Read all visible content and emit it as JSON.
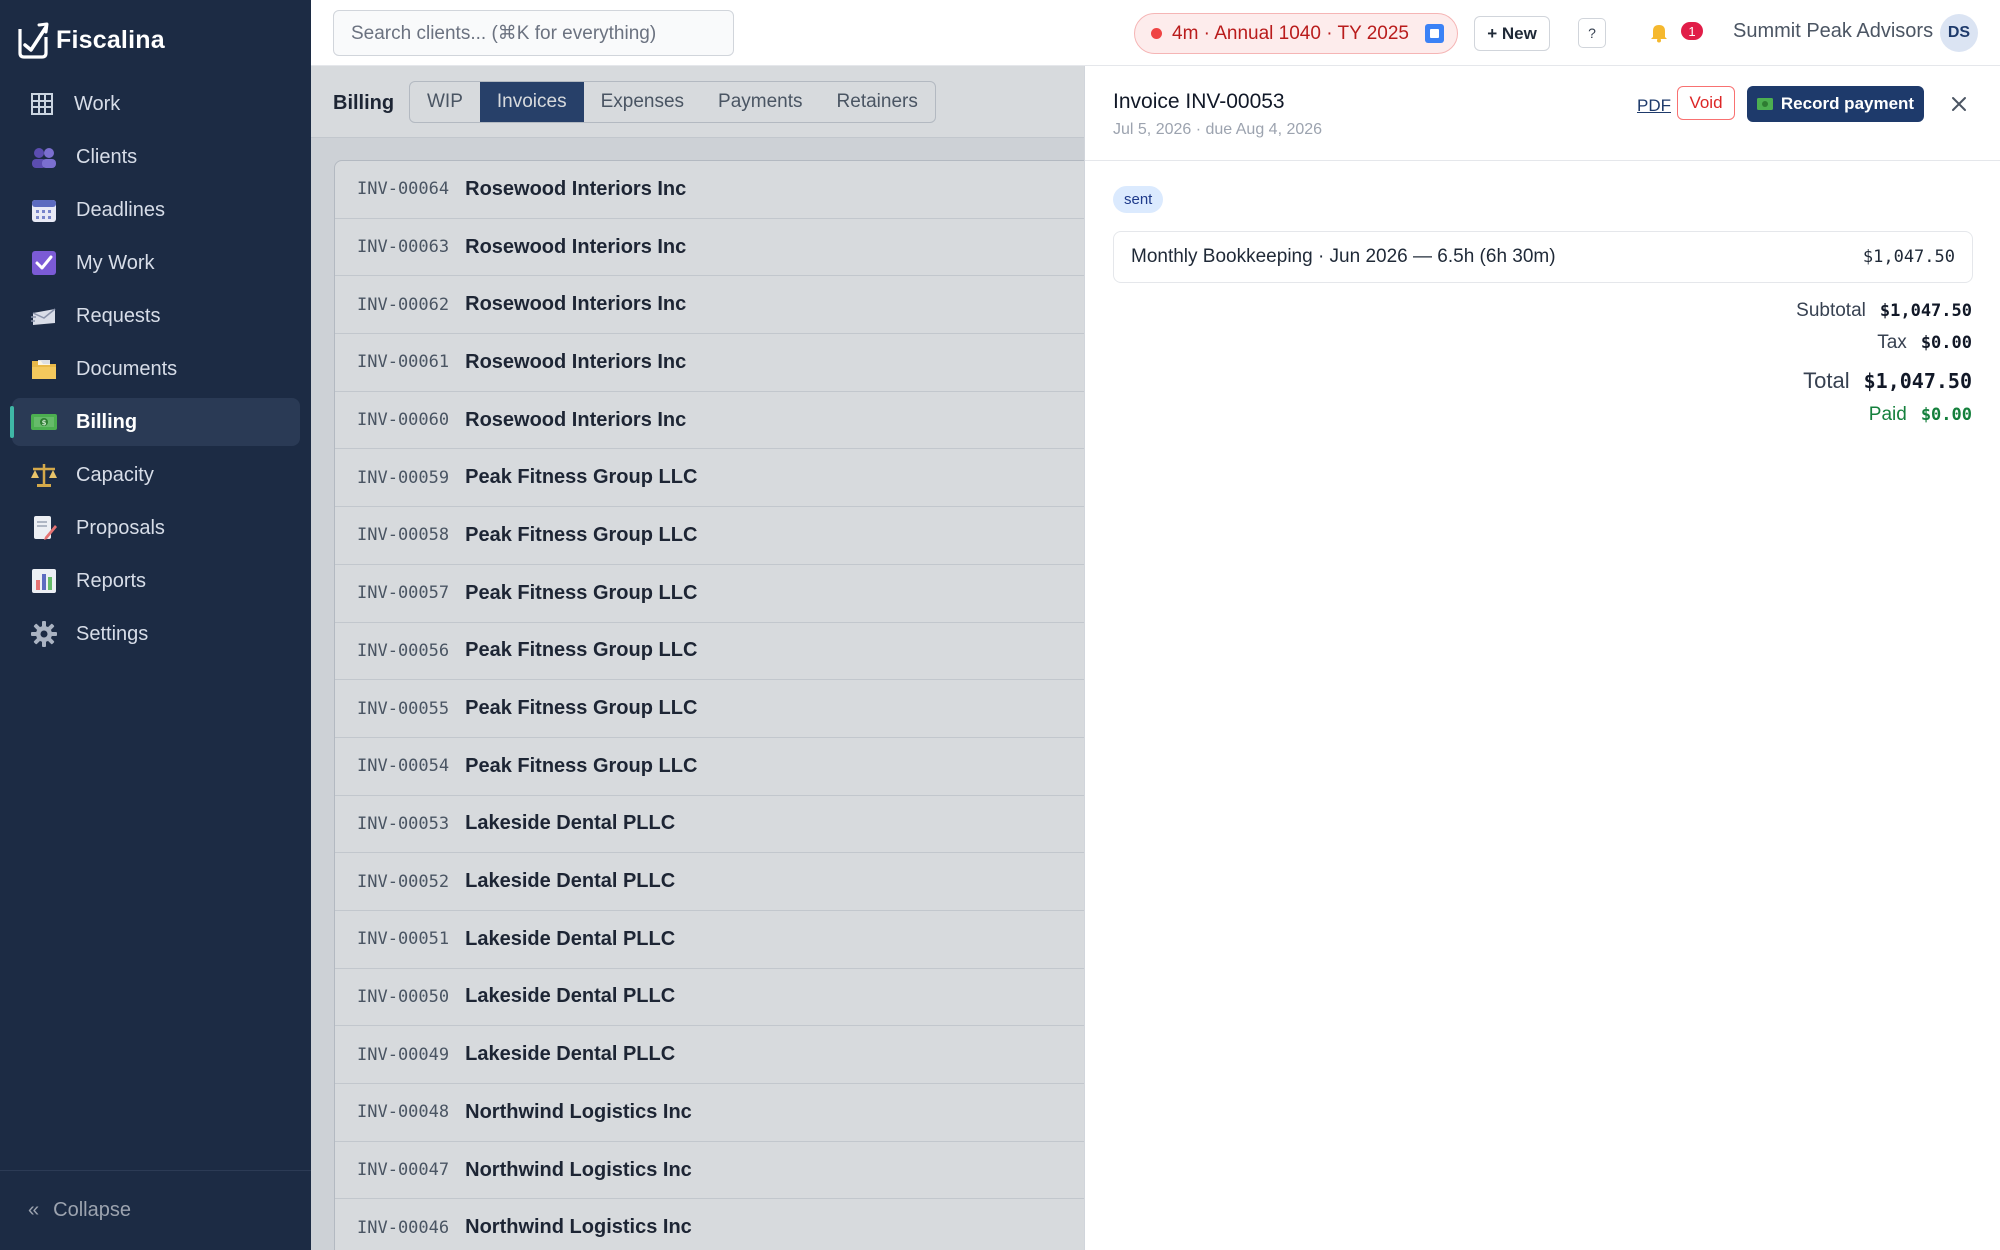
{
  "app": {
    "name": "Fiscalina"
  },
  "sidebar": {
    "items": [
      {
        "label": "Work",
        "icon": "grid-icon"
      },
      {
        "label": "Clients",
        "icon": "users-icon"
      },
      {
        "label": "Deadlines",
        "icon": "calendar-icon"
      },
      {
        "label": "My Work",
        "icon": "checkbox-icon"
      },
      {
        "label": "Requests",
        "icon": "envelope-icon"
      },
      {
        "label": "Documents",
        "icon": "folder-icon"
      },
      {
        "label": "Billing",
        "icon": "money-icon",
        "active": true
      },
      {
        "label": "Capacity",
        "icon": "scale-icon"
      },
      {
        "label": "Proposals",
        "icon": "document-pencil-icon"
      },
      {
        "label": "Reports",
        "icon": "bar-chart-icon"
      },
      {
        "label": "Settings",
        "icon": "gear-icon"
      }
    ],
    "collapse_label": "Collapse"
  },
  "topbar": {
    "search_placeholder": "Search clients... (⌘K for everything)",
    "timer_label": "4m · Annual 1040 · TY 2025",
    "new_label": "+ New",
    "help_label": "?",
    "notification_count": "1",
    "firm_name": "Summit Peak Advisors",
    "user_initials": "DS"
  },
  "billing": {
    "title": "Billing",
    "tabs": [
      "WIP",
      "Invoices",
      "Expenses",
      "Payments",
      "Retainers"
    ],
    "active_tab": "Invoices"
  },
  "invoices": [
    {
      "number": "INV-00064",
      "client": "Rosewood Interiors Inc"
    },
    {
      "number": "INV-00063",
      "client": "Rosewood Interiors Inc"
    },
    {
      "number": "INV-00062",
      "client": "Rosewood Interiors Inc"
    },
    {
      "number": "INV-00061",
      "client": "Rosewood Interiors Inc"
    },
    {
      "number": "INV-00060",
      "client": "Rosewood Interiors Inc"
    },
    {
      "number": "INV-00059",
      "client": "Peak Fitness Group LLC"
    },
    {
      "number": "INV-00058",
      "client": "Peak Fitness Group LLC"
    },
    {
      "number": "INV-00057",
      "client": "Peak Fitness Group LLC"
    },
    {
      "number": "INV-00056",
      "client": "Peak Fitness Group LLC"
    },
    {
      "number": "INV-00055",
      "client": "Peak Fitness Group LLC"
    },
    {
      "number": "INV-00054",
      "client": "Peak Fitness Group LLC"
    },
    {
      "number": "INV-00053",
      "client": "Lakeside Dental PLLC"
    },
    {
      "number": "INV-00052",
      "client": "Lakeside Dental PLLC"
    },
    {
      "number": "INV-00051",
      "client": "Lakeside Dental PLLC"
    },
    {
      "number": "INV-00050",
      "client": "Lakeside Dental PLLC"
    },
    {
      "number": "INV-00049",
      "client": "Lakeside Dental PLLC"
    },
    {
      "number": "INV-00048",
      "client": "Northwind Logistics Inc"
    },
    {
      "number": "INV-00047",
      "client": "Northwind Logistics Inc"
    },
    {
      "number": "INV-00046",
      "client": "Northwind Logistics Inc"
    }
  ],
  "drawer": {
    "title": "Invoice INV-00053",
    "dates": "Jul 5, 2026 · due Aug 4, 2026",
    "pdf_label": "PDF",
    "void_label": "Void",
    "record_payment_label": "Record payment",
    "status": "sent",
    "line_items": [
      {
        "description": "Monthly Bookkeeping · Jun 2026 — 6.5h (6h 30m)",
        "amount": "$1,047.50"
      }
    ],
    "totals": {
      "subtotal_label": "Subtotal",
      "subtotal": "$1,047.50",
      "tax_label": "Tax",
      "tax": "$0.00",
      "total_label": "Total",
      "total": "$1,047.50",
      "paid_label": "Paid",
      "paid": "$0.00"
    }
  },
  "colors": {
    "sidebar_bg": "#1c2b44",
    "primary": "#1e3a6b",
    "active_indicator": "#3fb7a6",
    "danger": "#dc2626",
    "paid_green": "#15803d"
  }
}
